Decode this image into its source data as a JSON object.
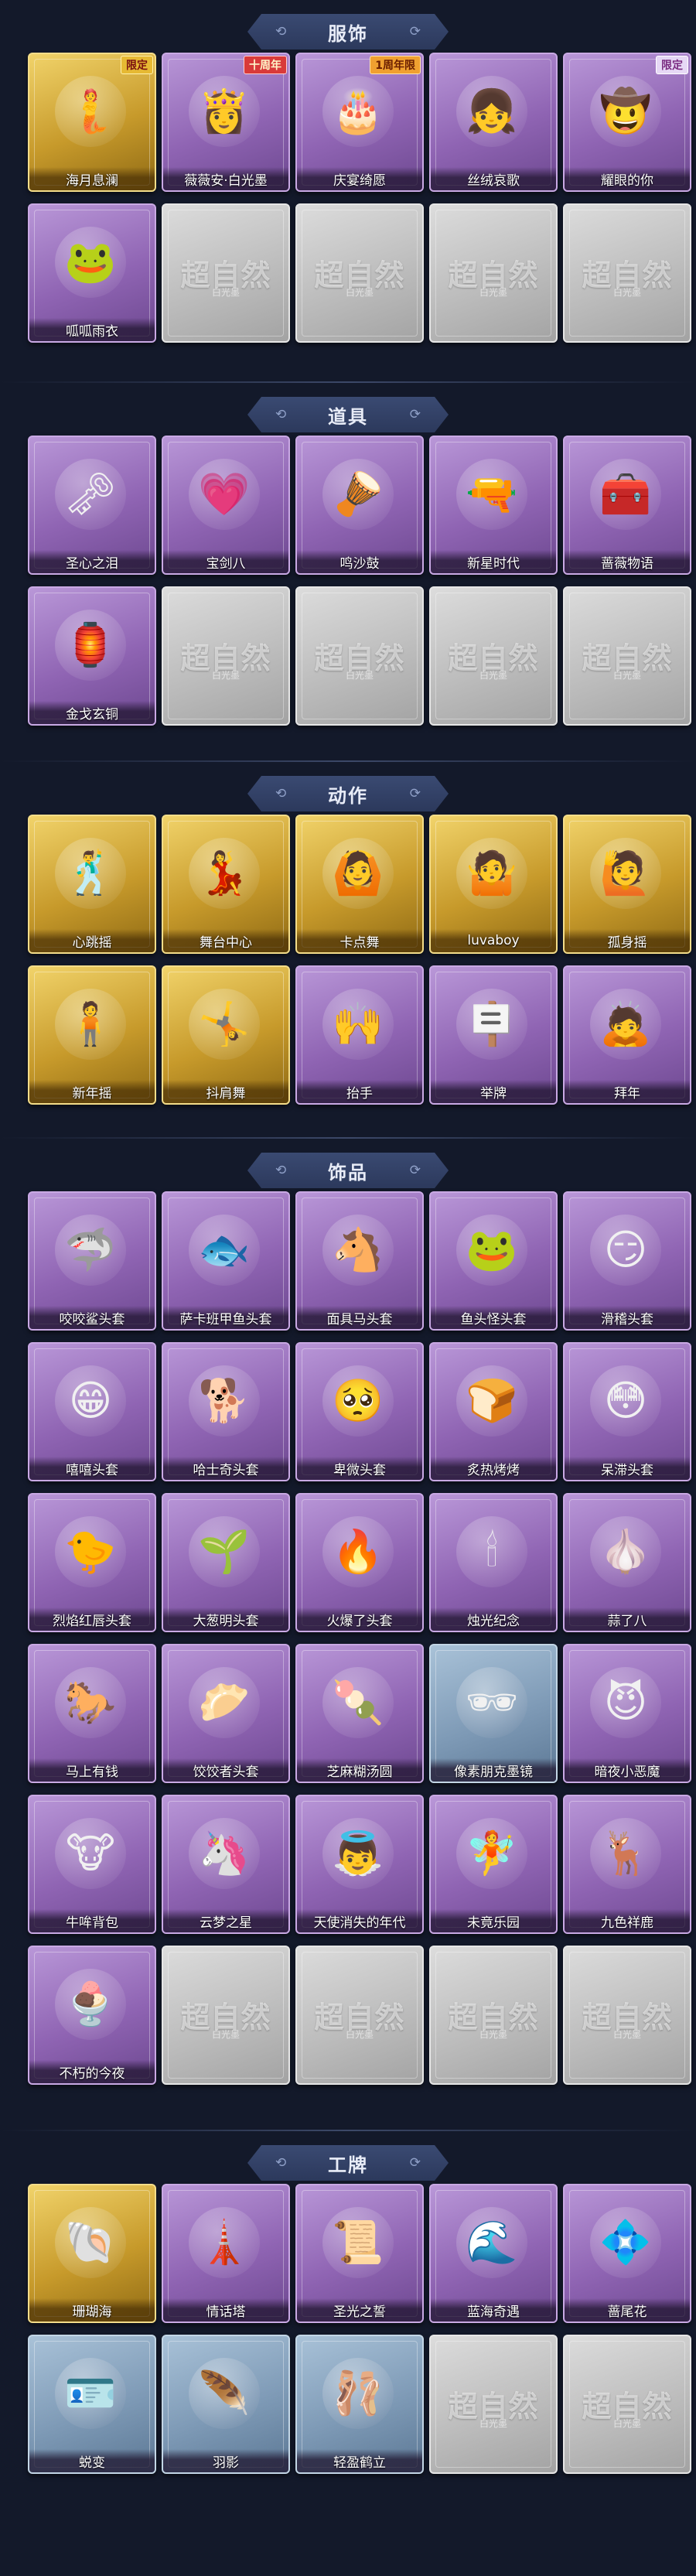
{
  "sections": [
    {
      "key": "clothing",
      "title": "服饰",
      "items": [
        {
          "label": "海月息澜",
          "rarity": "gold",
          "icon": "mermaid-portrait-icon",
          "glyph": "🧜",
          "badge": "限定",
          "badge_style": "gold"
        },
        {
          "label": "薇薇安·白光墨",
          "rarity": "purple",
          "icon": "lady-portrait-icon",
          "glyph": "👸",
          "badge": "十周年",
          "badge_style": "red"
        },
        {
          "label": "庆宴绮愿",
          "rarity": "purple",
          "icon": "cake-costume-icon",
          "glyph": "🎂",
          "badge": "1周年限",
          "badge_style": "orange"
        },
        {
          "label": "丝绒哀歌",
          "rarity": "purple",
          "icon": "gothic-girl-icon",
          "glyph": "👧",
          "badge": "",
          "badge_style": ""
        },
        {
          "label": "耀眼的你",
          "rarity": "purple",
          "icon": "cowgirl-icon",
          "glyph": "🤠",
          "badge": "限定",
          "badge_style": "lav"
        },
        {
          "label": "呱呱雨衣",
          "rarity": "purple",
          "icon": "frog-raincoat-icon",
          "glyph": "🐸",
          "badge": "",
          "badge_style": ""
        },
        {
          "label": "",
          "rarity": "empty"
        },
        {
          "label": "",
          "rarity": "empty"
        },
        {
          "label": "",
          "rarity": "empty"
        },
        {
          "label": "",
          "rarity": "empty"
        }
      ]
    },
    {
      "key": "props",
      "title": "道具",
      "items": [
        {
          "label": "圣心之泪",
          "rarity": "purple",
          "icon": "heart-scepter-icon",
          "glyph": "🗝"
        },
        {
          "label": "宝剑八",
          "rarity": "purple",
          "icon": "heart-sword-icon",
          "glyph": "💗"
        },
        {
          "label": "鸣沙鼓",
          "rarity": "purple",
          "icon": "dreamcatcher-drum-icon",
          "glyph": "🪘"
        },
        {
          "label": "新星时代",
          "rarity": "purple",
          "icon": "revolver-icon",
          "glyph": "🔫"
        },
        {
          "label": "蔷薇物语",
          "rarity": "purple",
          "icon": "medical-kit-icon",
          "glyph": "🧰"
        },
        {
          "label": "金戈玄铜",
          "rarity": "purple",
          "icon": "bronze-lantern-icon",
          "glyph": "🏮"
        },
        {
          "label": "",
          "rarity": "empty"
        },
        {
          "label": "",
          "rarity": "empty"
        },
        {
          "label": "",
          "rarity": "empty"
        },
        {
          "label": "",
          "rarity": "empty"
        }
      ]
    },
    {
      "key": "actions",
      "title": "动作",
      "items": [
        {
          "label": "心跳摇",
          "rarity": "gold",
          "icon": "pose-figure-icon",
          "glyph": "🕺"
        },
        {
          "label": "舞台中心",
          "rarity": "gold",
          "icon": "pose-figure-icon",
          "glyph": "💃"
        },
        {
          "label": "卡点舞",
          "rarity": "gold",
          "icon": "pose-figure-icon",
          "glyph": "🙆"
        },
        {
          "label": "luvaboy",
          "rarity": "gold",
          "icon": "pose-figure-icon",
          "glyph": "🤷"
        },
        {
          "label": "孤身摇",
          "rarity": "gold",
          "icon": "pose-figure-icon",
          "glyph": "🙋"
        },
        {
          "label": "新年摇",
          "rarity": "gold",
          "icon": "pose-figure-icon",
          "glyph": "🧍"
        },
        {
          "label": "抖肩舞",
          "rarity": "gold",
          "icon": "pose-figure-icon",
          "glyph": "🤸"
        },
        {
          "label": "抬手",
          "rarity": "purple",
          "icon": "raise-hand-icon",
          "glyph": "🙌"
        },
        {
          "label": "举牌",
          "rarity": "purple",
          "icon": "hold-sign-icon",
          "glyph": "🪧"
        },
        {
          "label": "拜年",
          "rarity": "purple",
          "icon": "bow-greeting-icon",
          "glyph": "🙇"
        }
      ]
    },
    {
      "key": "accessories",
      "title": "饰品",
      "items": [
        {
          "label": "咬咬鲨头套",
          "rarity": "purple",
          "icon": "shark-head-icon",
          "glyph": "🦈"
        },
        {
          "label": "萨卡班甲鱼头套",
          "rarity": "purple",
          "icon": "fish-head-icon",
          "glyph": "🐟"
        },
        {
          "label": "面具马头套",
          "rarity": "purple",
          "icon": "horse-head-icon",
          "glyph": "🐴"
        },
        {
          "label": "鱼头怪头套",
          "rarity": "purple",
          "icon": "fishman-head-icon",
          "glyph": "🐸"
        },
        {
          "label": "滑稽头套",
          "rarity": "purple",
          "icon": "smirk-face-icon",
          "glyph": "😏"
        },
        {
          "label": "嘻嘻头套",
          "rarity": "purple",
          "icon": "grin-face-icon",
          "glyph": "😁"
        },
        {
          "label": "哈士奇头套",
          "rarity": "purple",
          "icon": "husky-head-icon",
          "glyph": "🐕"
        },
        {
          "label": "卑微头套",
          "rarity": "purple",
          "icon": "pleading-face-icon",
          "glyph": "🥺"
        },
        {
          "label": "炙热烤烤",
          "rarity": "purple",
          "icon": "toast-face-icon",
          "glyph": "🍞"
        },
        {
          "label": "呆滞头套",
          "rarity": "purple",
          "icon": "dazed-face-icon",
          "glyph": "😳"
        },
        {
          "label": "烈焰红唇头套",
          "rarity": "purple",
          "icon": "yellow-creature-icon",
          "glyph": "🐤"
        },
        {
          "label": "大葱明头套",
          "rarity": "purple",
          "icon": "scallion-head-icon",
          "glyph": "🌱"
        },
        {
          "label": "火爆了头套",
          "rarity": "purple",
          "icon": "fire-head-icon",
          "glyph": "🔥"
        },
        {
          "label": "烛光纪念",
          "rarity": "purple",
          "icon": "candle-head-icon",
          "glyph": "🕯"
        },
        {
          "label": "蒜了八",
          "rarity": "purple",
          "icon": "garlic-head-icon",
          "glyph": "🧄"
        },
        {
          "label": "马上有钱",
          "rarity": "purple",
          "icon": "lucky-horse-icon",
          "glyph": "🐎"
        },
        {
          "label": "饺饺者头套",
          "rarity": "purple",
          "icon": "dumpling-head-icon",
          "glyph": "🥟"
        },
        {
          "label": "芝麻糊汤圆",
          "rarity": "purple",
          "icon": "tangyuan-head-icon",
          "glyph": "🍡"
        },
        {
          "label": "像素朋克墨镜",
          "rarity": "blue",
          "icon": "pixel-sunglasses-icon",
          "glyph": "🕶"
        },
        {
          "label": "暗夜小恶魔",
          "rarity": "purple",
          "icon": "devil-girl-icon",
          "glyph": "😈"
        },
        {
          "label": "牛哞背包",
          "rarity": "purple",
          "icon": "cow-backpack-icon",
          "glyph": "🐮"
        },
        {
          "label": "云梦之星",
          "rarity": "purple",
          "icon": "unicorn-star-icon",
          "glyph": "🦄"
        },
        {
          "label": "天使消失的年代",
          "rarity": "purple",
          "icon": "angel-doll-icon",
          "glyph": "👼"
        },
        {
          "label": "未竟乐园",
          "rarity": "purple",
          "icon": "fairy-doll-icon",
          "glyph": "🧚"
        },
        {
          "label": "九色祥鹿",
          "rarity": "purple",
          "icon": "deer-ornament-icon",
          "glyph": "🦌"
        },
        {
          "label": "不朽的今夜",
          "rarity": "purple",
          "icon": "dessert-cup-icon",
          "glyph": "🍨"
        },
        {
          "label": "",
          "rarity": "empty"
        },
        {
          "label": "",
          "rarity": "empty"
        },
        {
          "label": "",
          "rarity": "empty"
        },
        {
          "label": "",
          "rarity": "empty"
        }
      ]
    },
    {
      "key": "badges",
      "title": "工牌",
      "items": [
        {
          "label": "珊瑚海",
          "rarity": "gold",
          "icon": "coral-sea-card-icon",
          "glyph": "🐚"
        },
        {
          "label": "情话塔",
          "rarity": "purple",
          "icon": "tower-card-icon",
          "glyph": "🗼"
        },
        {
          "label": "圣光之誓",
          "rarity": "purple",
          "icon": "holy-light-card-icon",
          "glyph": "📜"
        },
        {
          "label": "蓝海奇遇",
          "rarity": "purple",
          "icon": "blue-sea-card-icon",
          "glyph": "🌊"
        },
        {
          "label": "蔷尾花",
          "rarity": "purple",
          "icon": "iris-card-icon",
          "glyph": "💠"
        },
        {
          "label": "蜕变",
          "rarity": "blue",
          "icon": "blank-card-icon",
          "glyph": "🪪"
        },
        {
          "label": "羽影",
          "rarity": "blue",
          "icon": "feather-shadow-card-icon",
          "glyph": "🪶"
        },
        {
          "label": "轻盈鹤立",
          "rarity": "blue",
          "icon": "dancer-card-icon",
          "glyph": "🩰"
        },
        {
          "label": "",
          "rarity": "empty"
        },
        {
          "label": "",
          "rarity": "empty"
        }
      ]
    }
  ],
  "placeholder": {
    "watermark": "超自然",
    "watermark_sub": "白光墨"
  },
  "colors": {
    "background": "#13192a",
    "header": "#2c395c",
    "purple": "#8f64b3",
    "gold": "#c79a2b",
    "blue": "#7e9ab6",
    "empty": "#bdbdbd"
  }
}
